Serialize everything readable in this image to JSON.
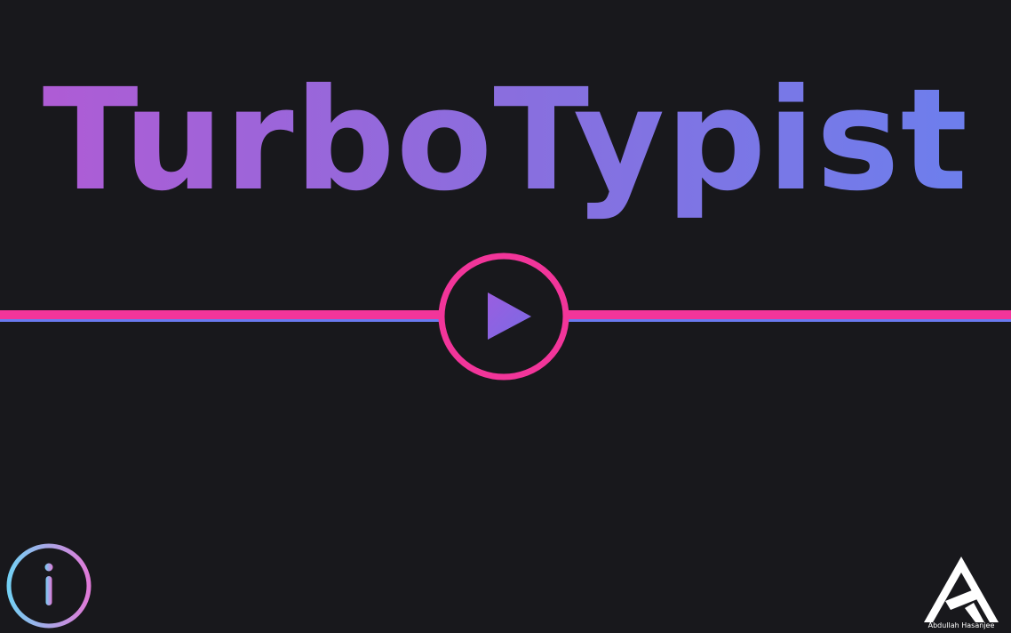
{
  "game": {
    "title": "TurboTypist"
  },
  "controls": {
    "play_icon": "play-icon",
    "info_icon": "info-icon"
  },
  "branding": {
    "logo_icon": "ah-monogram-icon",
    "author": "Abdullah Hasanjee"
  },
  "colors": {
    "background": "#18181c",
    "title_gradient_start": "#b25ad4",
    "title_gradient_end": "#6a80ee",
    "accent_pink": "#f2359a",
    "accent_blue": "#6a7af0",
    "play_triangle": "#8a62de",
    "info_gradient_start": "#74d0f4",
    "info_gradient_end": "#e07ad8"
  }
}
